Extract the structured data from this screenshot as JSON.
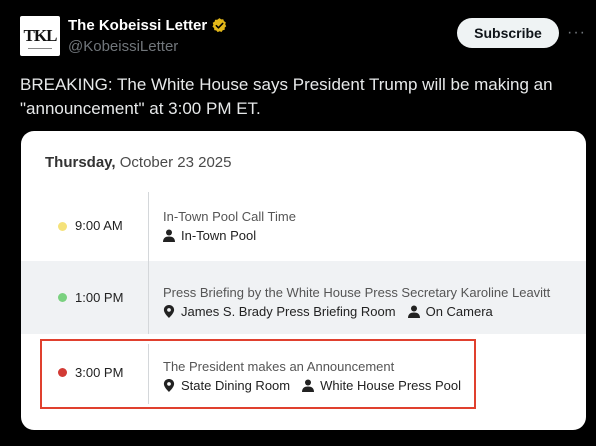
{
  "account": {
    "name": "The Kobeissi Letter",
    "handle": "@KobeissiLetter",
    "avatar_text": "TKL",
    "verified_color": "#e2b719"
  },
  "actions": {
    "subscribe_label": "Subscribe",
    "more_label": "···"
  },
  "tweet": {
    "text": "BREAKING: The White House says President Trump will be making an \"announcement\" at 3:00 PM ET."
  },
  "schedule": {
    "weekday": "Thursday,",
    "date": "October 23 2025",
    "events": [
      {
        "time": "9:00 AM",
        "dot_color": "#f5e27a",
        "title": "In-Town Pool Call Time",
        "details": [
          {
            "icon": "person-icon",
            "text": "In-Town Pool"
          }
        ]
      },
      {
        "time": "1:00 PM",
        "dot_color": "#7ad17f",
        "title": "Press Briefing by the White House Press Secretary Karoline Leavitt",
        "details": [
          {
            "icon": "location-pin-icon",
            "text": "James S. Brady Press Briefing Room"
          },
          {
            "icon": "person-icon",
            "text": "On Camera"
          }
        ]
      },
      {
        "time": "3:00 PM",
        "dot_color": "#d23b35",
        "title": "The President makes an Announcement",
        "details": [
          {
            "icon": "location-pin-icon",
            "text": "State Dining Room"
          },
          {
            "icon": "person-icon",
            "text": "White House Press Pool"
          }
        ]
      }
    ],
    "highlight_color": "#e0402e"
  }
}
